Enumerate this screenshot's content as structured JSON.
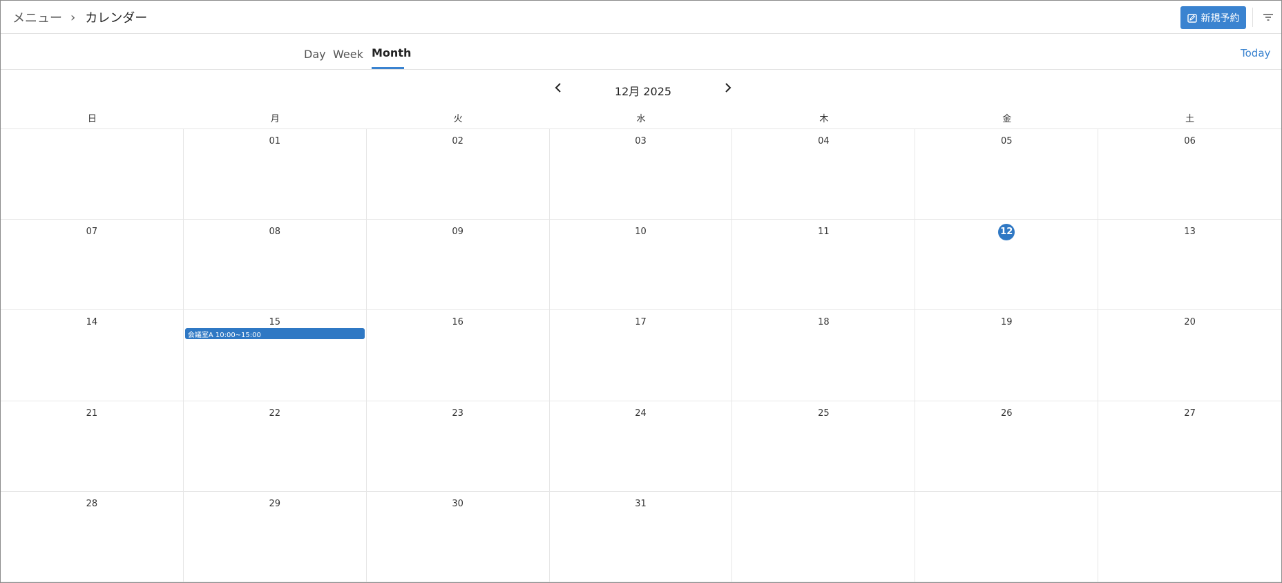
{
  "header": {
    "breadcrumb": {
      "menu": "メニュー",
      "separator": "›",
      "current": "カレンダー"
    },
    "new_button_label": "新規予約"
  },
  "tabs": {
    "day": "Day",
    "week": "Week",
    "month": "Month",
    "active": "Month"
  },
  "today_label": "Today",
  "month_nav": {
    "title": "12月 2025"
  },
  "weekdays": [
    "日",
    "月",
    "火",
    "水",
    "木",
    "金",
    "土"
  ],
  "days": [
    "",
    "01",
    "02",
    "03",
    "04",
    "05",
    "06",
    "07",
    "08",
    "09",
    "10",
    "11",
    "12",
    "13",
    "14",
    "15",
    "16",
    "17",
    "18",
    "19",
    "20",
    "21",
    "22",
    "23",
    "24",
    "25",
    "26",
    "27",
    "28",
    "29",
    "30",
    "31",
    "",
    "",
    ""
  ],
  "today": "12",
  "events": [
    {
      "day": "15",
      "label": "会議室A 10:00~15:00"
    }
  ],
  "colors": {
    "accent": "#3a83d0",
    "today_badge": "#2f78c4",
    "event": "#2f78c4"
  },
  "icons": {
    "prev": "chevron-left-icon",
    "next": "chevron-right-icon",
    "new": "calendar-edit-icon",
    "filter": "filter-icon"
  }
}
